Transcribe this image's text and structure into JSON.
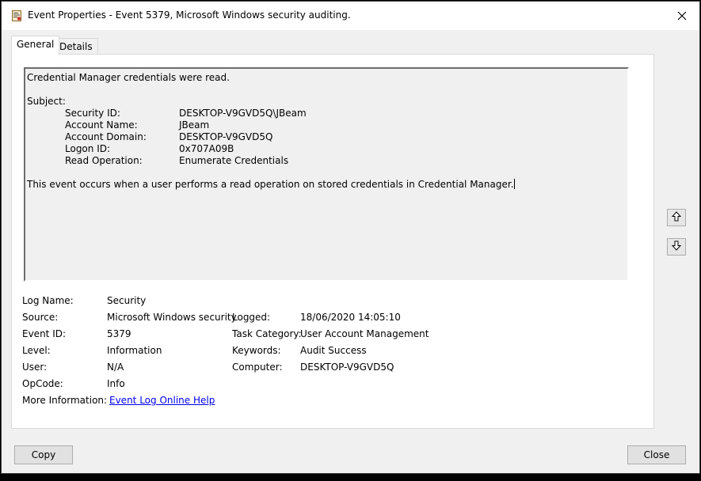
{
  "window": {
    "title": "Event Properties - Event 5379, Microsoft Windows security auditing.",
    "icons": {
      "app": "event-log-icon",
      "close": "close-icon"
    }
  },
  "tabs": [
    {
      "label": "General",
      "selected": true
    },
    {
      "label": "Details",
      "selected": false
    }
  ],
  "description": {
    "headline": "Credential Manager credentials were read.",
    "subject_label": "Subject:",
    "rows": [
      {
        "label": "Security ID:",
        "value": "DESKTOP-V9GVD5Q\\JBeam"
      },
      {
        "label": "Account Name:",
        "value": "JBeam"
      },
      {
        "label": "Account Domain:",
        "value": "DESKTOP-V9GVD5Q"
      },
      {
        "label": "Logon ID:",
        "value": "0x707A09B"
      },
      {
        "label": "Read Operation:",
        "value": "Enumerate Credentials"
      }
    ],
    "footer": "This event occurs when a user performs a read operation on stored credentials in Credential Manager."
  },
  "details": {
    "log_name": {
      "label": "Log Name:",
      "value": "Security"
    },
    "source": {
      "label": "Source:",
      "value": "Microsoft Windows security"
    },
    "logged": {
      "label": "Logged:",
      "value": "18/06/2020 14:05:10"
    },
    "event_id": {
      "label": "Event ID:",
      "value": "5379"
    },
    "task_category": {
      "label": "Task Category:",
      "value": "User Account Management"
    },
    "level": {
      "label": "Level:",
      "value": "Information"
    },
    "keywords": {
      "label": "Keywords:",
      "value": "Audit Success"
    },
    "user": {
      "label": "User:",
      "value": "N/A"
    },
    "computer": {
      "label": "Computer:",
      "value": "DESKTOP-V9GVD5Q"
    },
    "opcode": {
      "label": "OpCode:",
      "value": "Info"
    },
    "more_info": {
      "label": "More Information:",
      "link": "Event Log Online Help"
    }
  },
  "nav": {
    "up_icon": "arrow-up-icon",
    "down_icon": "arrow-down-icon"
  },
  "buttons": {
    "copy": "Copy",
    "close": "Close"
  }
}
